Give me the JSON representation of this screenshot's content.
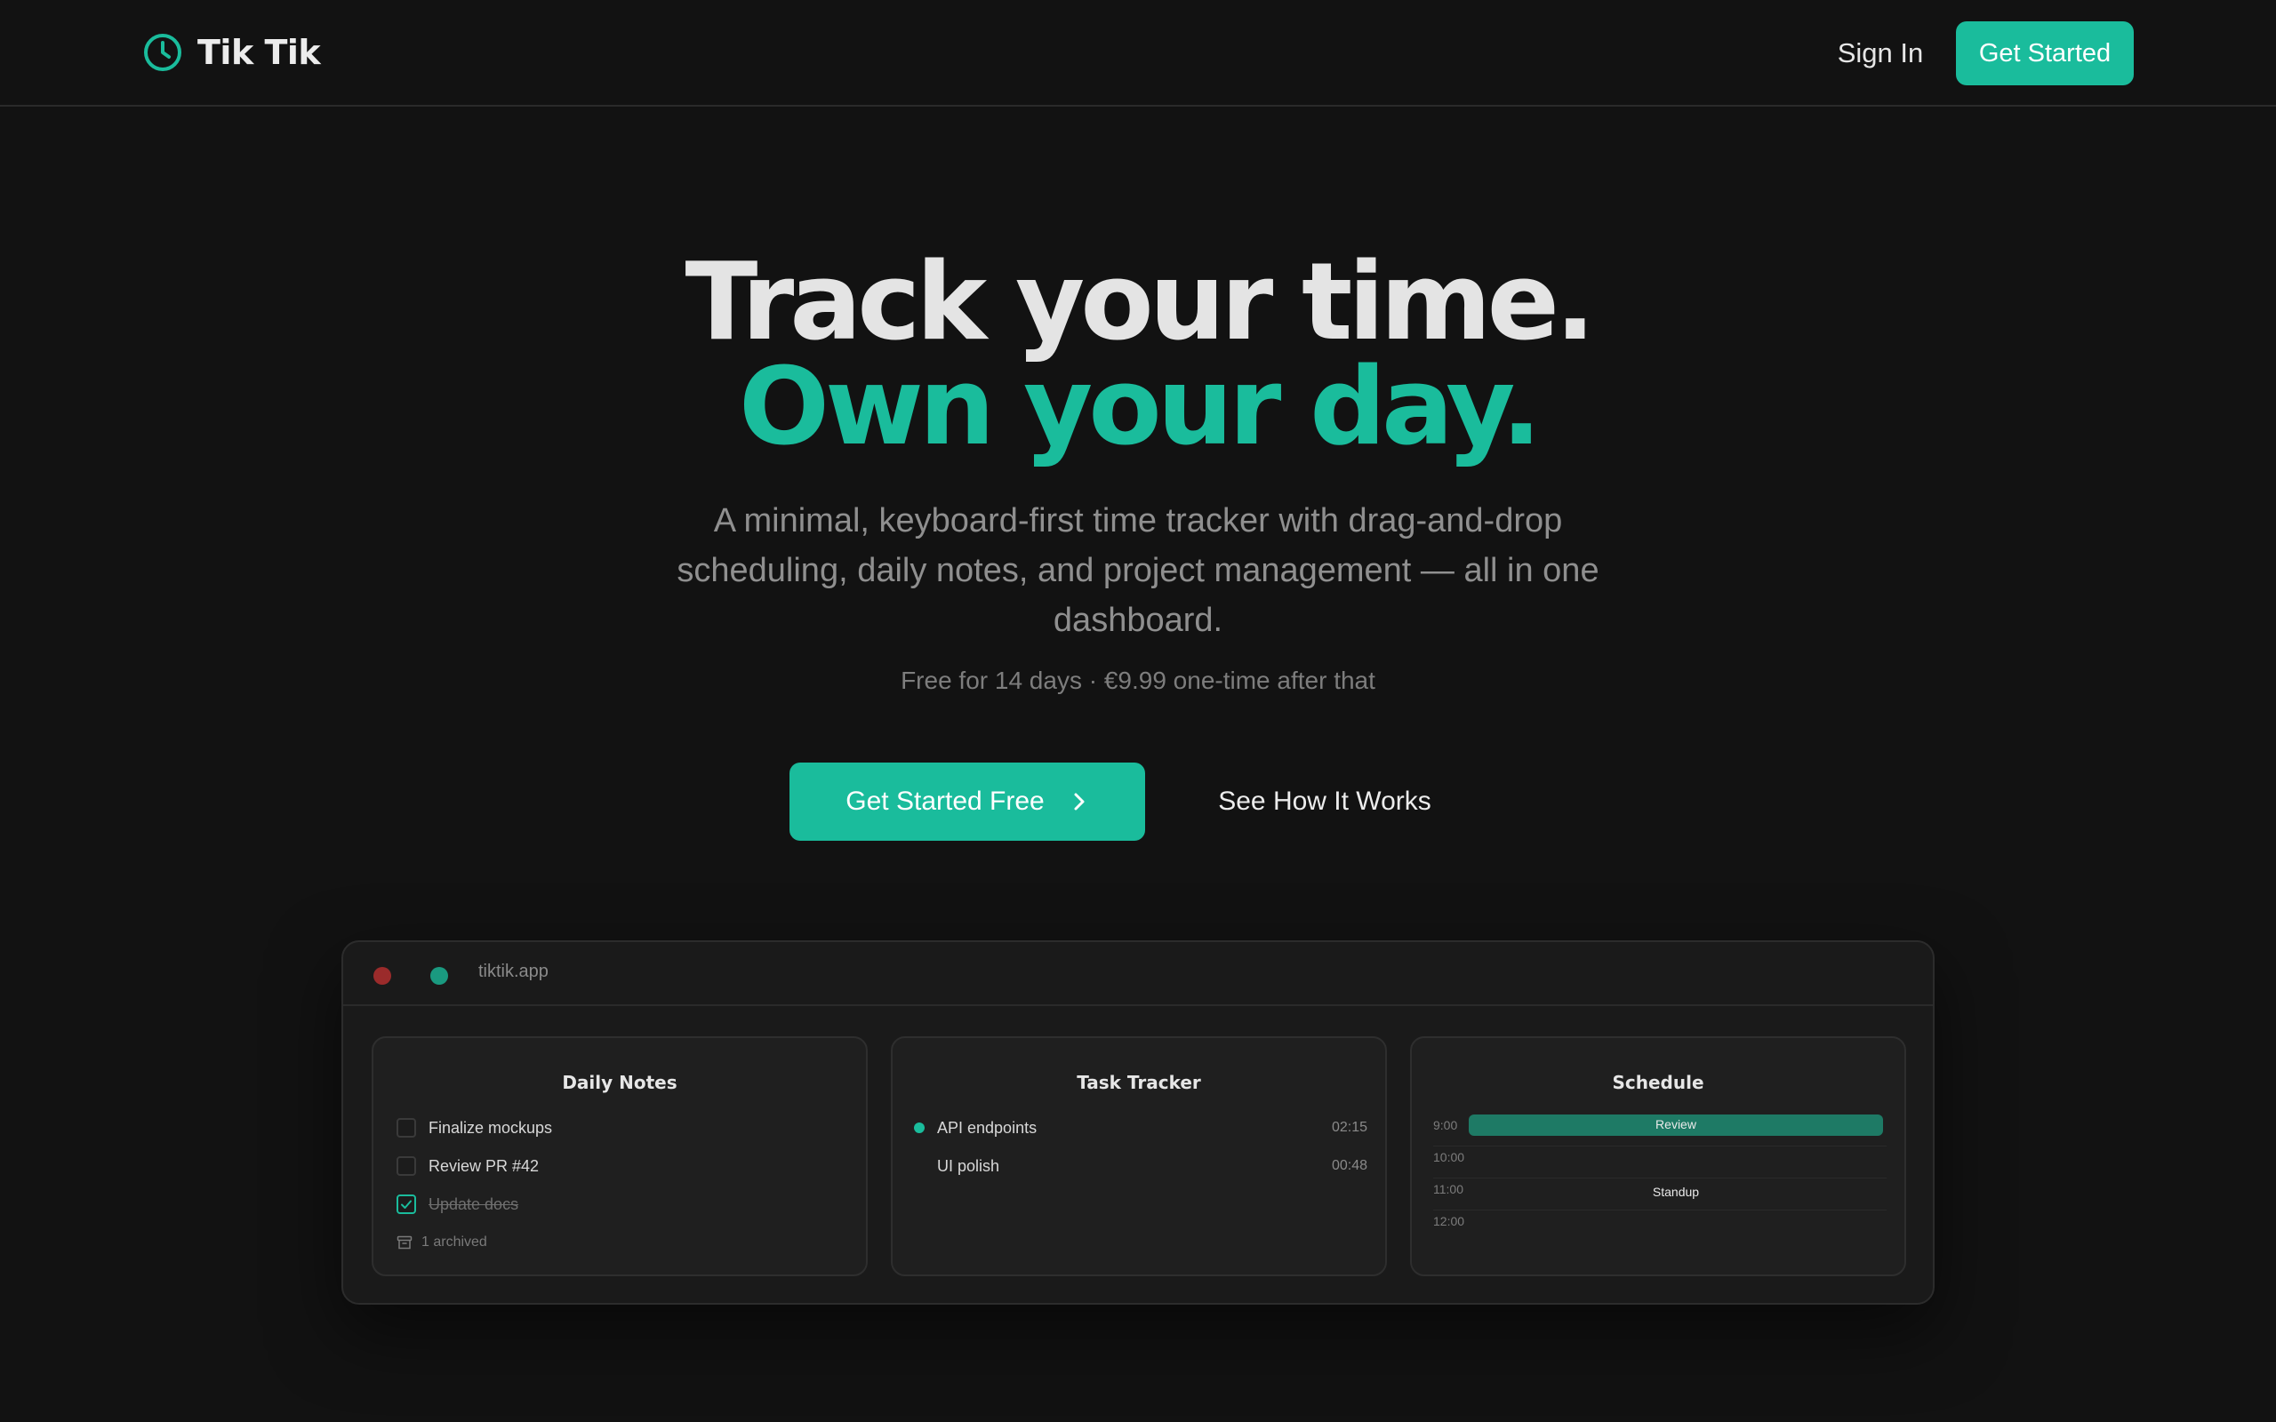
{
  "nav": {
    "brand": "Tik Tik",
    "signin": "Sign In",
    "cta": "Get Started"
  },
  "hero": {
    "line1": "Track your time.",
    "line2": "Own your day.",
    "subtitle": "A minimal, keyboard-first time tracker with drag-and-drop scheduling, daily notes, and project management — all in one dashboard.",
    "pricing": "Free for 14 days · €9.99 one-time after that",
    "cta_primary": "Get Started Free",
    "cta_secondary": "See How It Works"
  },
  "preview": {
    "url": "tiktik.app",
    "daily_notes": {
      "title": "Daily Notes",
      "items": [
        {
          "text": "Finalize mockups",
          "done": false
        },
        {
          "text": "Review PR #42",
          "done": false
        },
        {
          "text": "Update docs",
          "done": true
        }
      ],
      "archived": "1 archived"
    },
    "task_tracker": {
      "title": "Task Tracker",
      "tasks": [
        {
          "name": "API endpoints",
          "time": "02:15",
          "active": true
        },
        {
          "name": "UI polish",
          "time": "00:48",
          "active": false
        }
      ]
    },
    "schedule": {
      "title": "Schedule",
      "rows": [
        {
          "time": "9:00",
          "event": "Review",
          "highlight": true
        },
        {
          "time": "10:00",
          "event": "",
          "highlight": false
        },
        {
          "time": "11:00",
          "event": "Standup",
          "highlight": false
        },
        {
          "time": "12:00",
          "event": "",
          "highlight": false
        }
      ]
    }
  },
  "colors": {
    "background": "#121212",
    "accent": "#1abc9c",
    "schedule_block": "#1e7a65",
    "window_dot_red": "#9b2b2b",
    "window_dot_green": "#1a9a80"
  },
  "icons": {
    "brand": "clock-icon",
    "cta_primary": "chevron-right-icon",
    "archived": "archive-box-icon",
    "checked": "checkmark-icon"
  }
}
